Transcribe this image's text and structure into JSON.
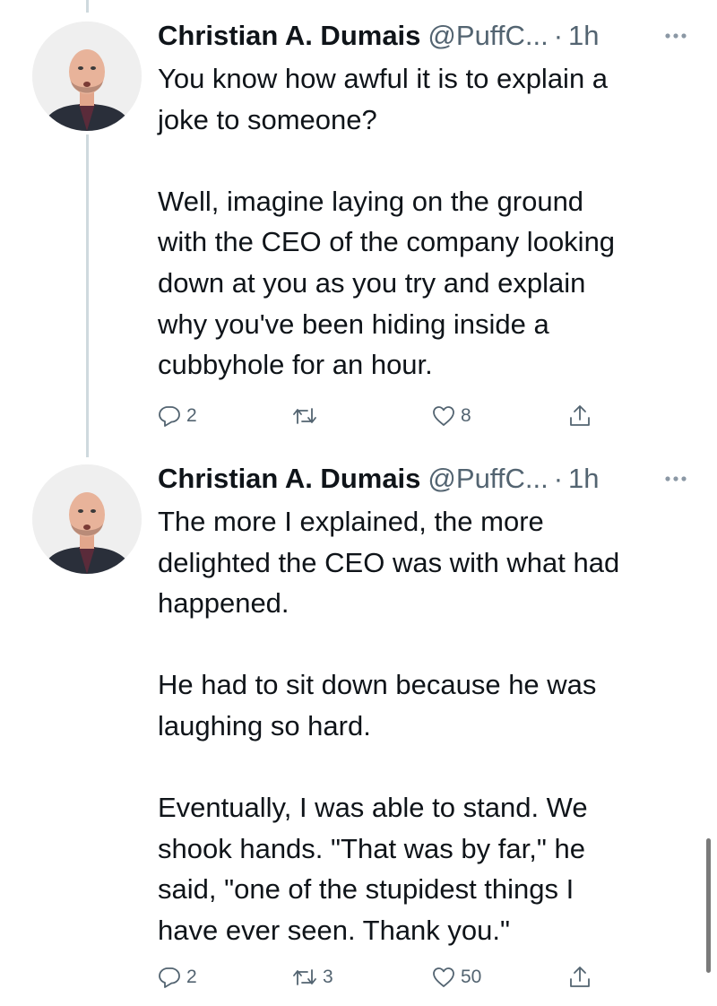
{
  "tweets": [
    {
      "author_name": "Christian A. Dumais",
      "handle": "@PuffC...",
      "separator": "·",
      "time": "1h",
      "paragraphs": [
        [
          "You know how awful it is to explain a",
          "joke to someone?"
        ],
        [
          "Well, imagine laying on the ground",
          "with the CEO of the company looking",
          "down at you as you try and explain",
          "why you've been hiding inside a",
          "cubbyhole for an hour."
        ]
      ],
      "replies": "2",
      "retweets": "",
      "likes": "8"
    },
    {
      "author_name": "Christian A. Dumais",
      "handle": "@PuffC...",
      "separator": "·",
      "time": "1h",
      "paragraphs": [
        [
          "The more I explained, the more",
          "delighted the CEO was with what had",
          "happened."
        ],
        [
          "He had to sit down because he was",
          "laughing so hard."
        ],
        [
          "Eventually, I was able to stand. We",
          "shook hands. \"That was by far,\" he",
          "said, \"one of the stupidest things I",
          "have ever seen. Thank you.\""
        ]
      ],
      "replies": "2",
      "retweets": "3",
      "likes": "50"
    }
  ],
  "icons": {
    "reply": "reply-icon",
    "retweet": "retweet-icon",
    "like": "heart-icon",
    "share": "share-icon",
    "more": "more-options-icon"
  },
  "colors": {
    "text": "#0f1419",
    "secondary": "#536471",
    "thread_line": "#cfd9de"
  }
}
